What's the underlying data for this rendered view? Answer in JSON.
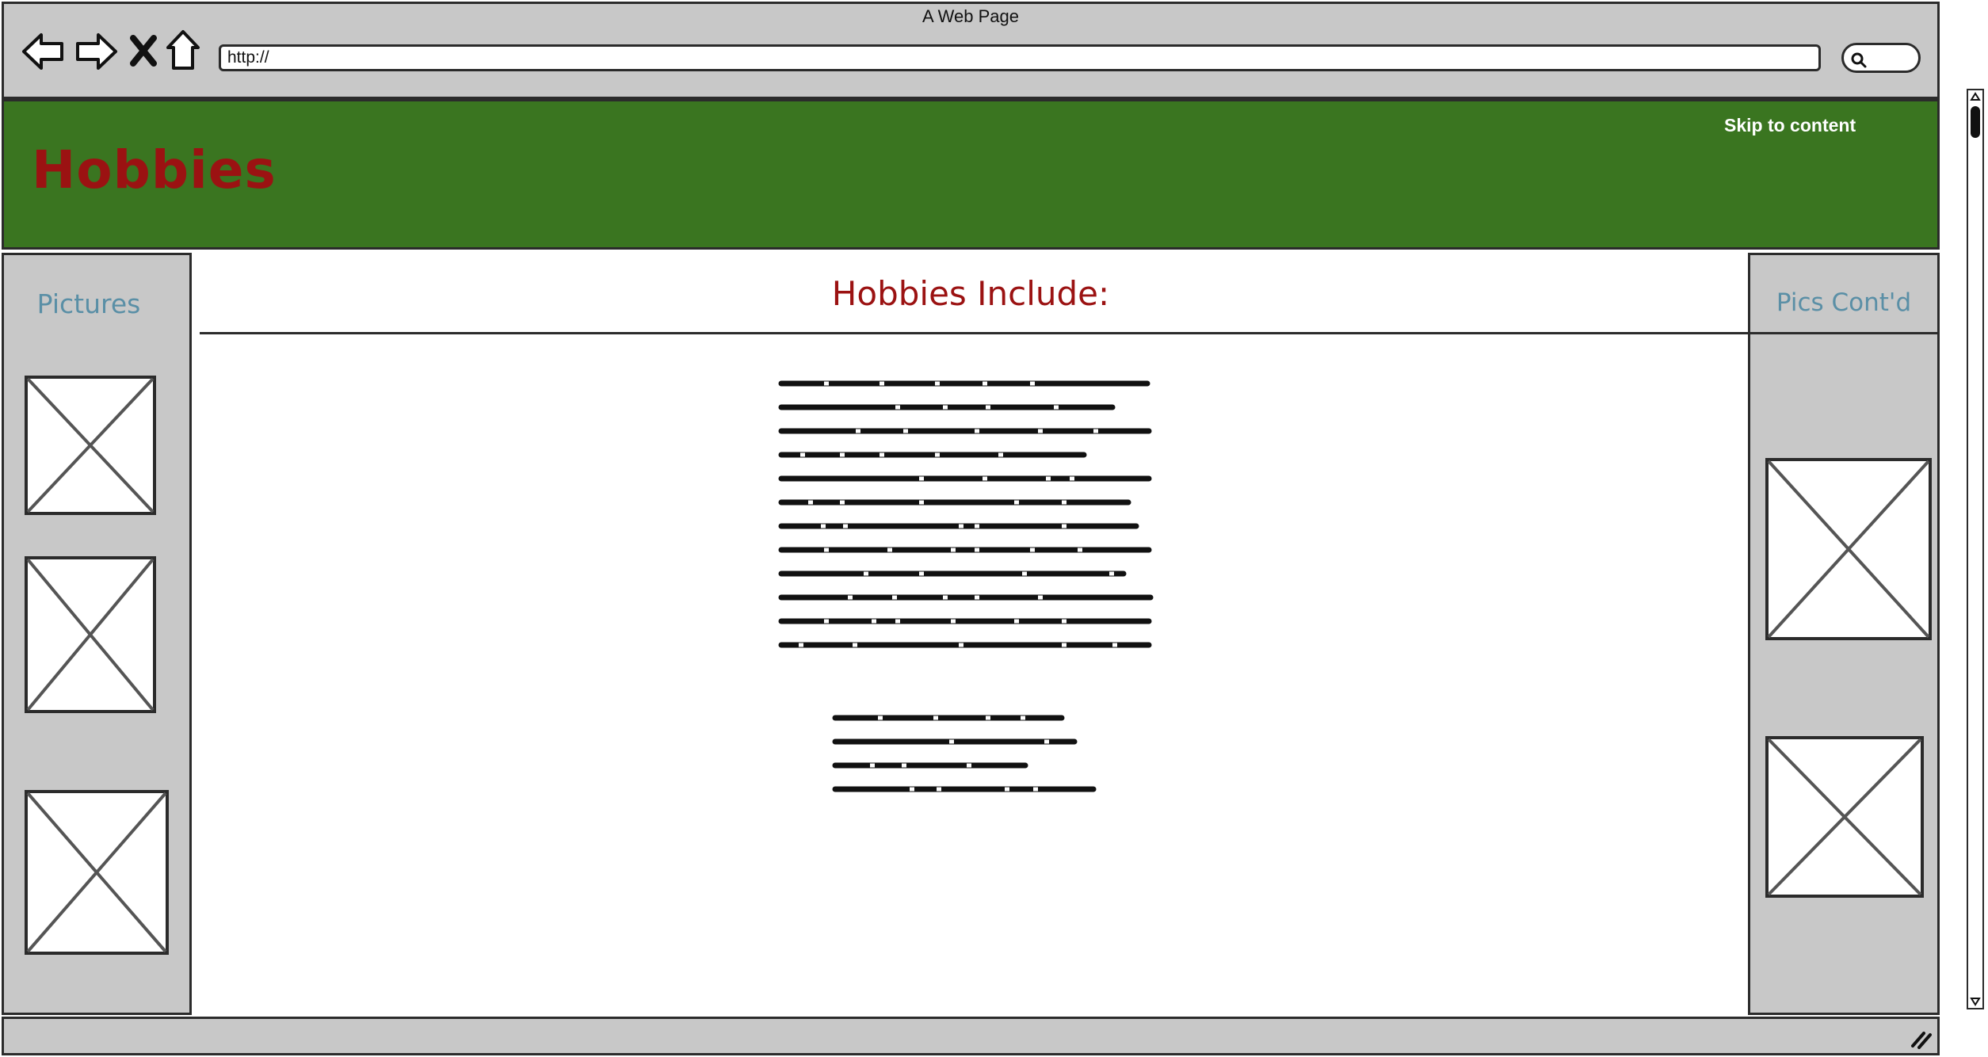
{
  "browser": {
    "window_title": "A Web Page",
    "url": "http://",
    "icons": [
      "back-arrow-icon",
      "forward-arrow-icon",
      "stop-icon",
      "home-icon",
      "search-icon"
    ]
  },
  "header": {
    "title": "Hobbies",
    "skip_link": "Skip to content",
    "colors": {
      "background": "#3a7520",
      "title": "#9b1212",
      "skip_link": "#ffffff"
    }
  },
  "left_sidebar": {
    "title": "Pictures",
    "image_count": 3
  },
  "main": {
    "heading": "Hobbies Include:",
    "paragraphs": [
      "lorem ipsum placeholder paragraph",
      "lorem ipsum placeholder paragraph"
    ]
  },
  "right_sidebar": {
    "title": "Pics Cont'd",
    "image_count": 2
  },
  "colors": {
    "chrome_gray": "#c8c8c8",
    "sidebar_title": "#5a8fa6",
    "heading": "#9b1212"
  }
}
